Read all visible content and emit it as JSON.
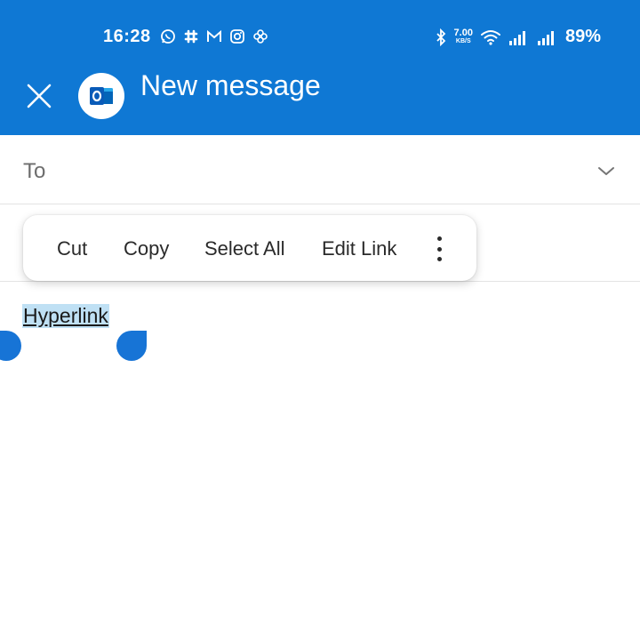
{
  "status_bar": {
    "time": "16:28",
    "notification_icons": [
      "whatsapp-icon",
      "slack-icon",
      "gmail-icon",
      "instagram-icon",
      "pinwheel-icon"
    ],
    "net_speed": "7.00",
    "net_speed_unit": "KB/S",
    "battery": "89%"
  },
  "header": {
    "title": "New message",
    "background_color": "#0f78d4",
    "app_icon": "outlook-icon"
  },
  "compose": {
    "to_label": "To"
  },
  "context_menu": {
    "items": [
      "Cut",
      "Copy",
      "Select All",
      "Edit Link"
    ]
  },
  "body": {
    "selected_text": "Hyperlink",
    "selection_color": "#bfe0f4",
    "handle_color": "#1774d6"
  }
}
